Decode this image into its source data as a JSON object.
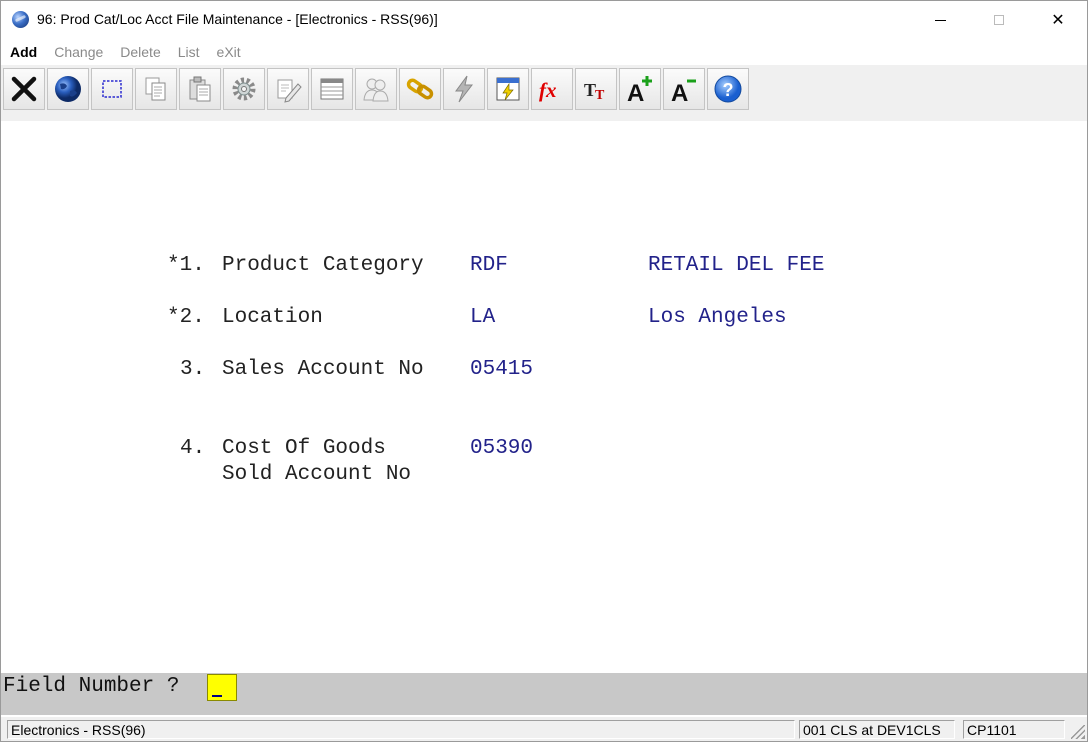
{
  "window": {
    "title": "96: Prod Cat/Loc Acct File Maintenance - [Electronics - RSS(96)]",
    "min_glyph": "",
    "close_glyph": "✕"
  },
  "menu": {
    "add": "Add",
    "change": "Change",
    "delete": "Delete",
    "list": "List",
    "exit": "eXit"
  },
  "toolbar": {
    "icons": [
      "close-icon",
      "globe-icon",
      "selection-icon",
      "copy-icon",
      "paste-icon",
      "settings-icon",
      "edit-icon",
      "table-icon",
      "users-icon",
      "link-icon",
      "lightning-icon",
      "calculator-icon",
      "function-icon",
      "font-icon",
      "increase-font-icon",
      "decrease-font-icon",
      "help-icon"
    ]
  },
  "form": {
    "field1": {
      "number": "*1.",
      "label": "Product Category",
      "value": "RDF",
      "description": "RETAIL DEL FEE"
    },
    "field2": {
      "number": "*2.",
      "label": "Location",
      "value": "LA",
      "description": "Los Angeles"
    },
    "field3": {
      "number": "3.",
      "label": "Sales Account No",
      "value": "05415"
    },
    "field4": {
      "number": "4.",
      "label_line1": "Cost Of Goods",
      "label_line2": "Sold Account No",
      "value": "05390"
    }
  },
  "prompt": {
    "text": "Field Number ?",
    "value": ""
  },
  "status": {
    "company": "Electronics - RSS(96)",
    "session": "001 CLS at DEV1CLS",
    "code": "CP1101"
  },
  "colors": {
    "value_text": "#22228a",
    "prompt_bg": "#c8c8c8",
    "input_bg": "#ffff00"
  }
}
